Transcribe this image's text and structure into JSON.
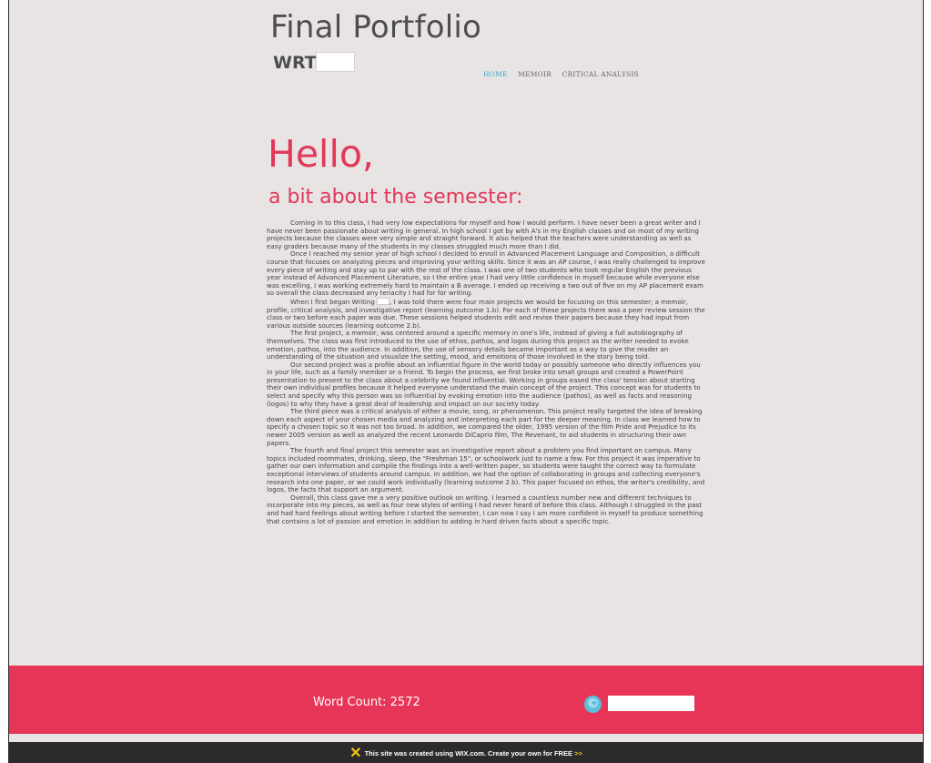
{
  "header": {
    "title": "Final Portfolio",
    "course": "WRT"
  },
  "nav": {
    "items": [
      "HOME",
      "MEMOIR",
      "CRITICAL ANALYSIS"
    ],
    "active": "HOME"
  },
  "main": {
    "greeting": "Hello,",
    "subtitle": "a bit about the semester:",
    "p1": "Coming in to this class, I had very low expectations for myself and how I would perform.  I have never been a great writer and I have never been passionate about writing in general.  In high school I got by with A's in my English classes and on most of my writing projects because the classes were very simple and straight forward.  It also helped that the teachers were understanding as well as easy graders because many of the students in my classes struggled much more than I did.",
    "p2": "Once I reached my senior year of high school I decided to enroll in Advanced Placement Language and Composition, a difficult course that focuses on analyzing pieces and improving your writing skills.  Since it was an AP course, I was really challenged to improve every piece of writing and stay up to par with the rest of the class.  I was one of two students who took regular English the previous year instead of Advanced Placement Literature, so I the entire year I had very little confidence in myself because while everyone else was excelling, I was working extremely hard to maintain a B average.  I ended up receiving a two out of five on my AP placement exam so overall the class decreased any tenacity I had for for writing.",
    "p3_before": "When I first began Writing ",
    "p3_after": ", I was told there were four main projects we would be focusing on this semester; a memoir, profile, critical analysis, and investigative report (learning outcome 1.b).  For each of these projects there was a peer review session the class or two before each paper was due.  These sessions helped students edit and revise their papers because they had input from various outside sources (learning outcome 2.b).",
    "p4": "The first project, a memoir, was centered around a specific memory in one's life, instead of giving a full autobiography of themselves.  The class was first introduced to the use of ethos, pathos, and logos during this project as the writer needed to evoke emotion, pathos, into the audience.  In addition, the use of sensory details became important as a way to give the reader an understanding of the situation and visualize the setting, mood, and emotions of those involved in the story being told.",
    "p5": "Our second project was a profile about an influential figure in the world today or possibly someone who directly influences you in your life, such as a family member or a friend.  To begin the process, we first broke into small groups and created a PowerPoint presentation to present to the class about a celebrity we found influential.  Working in groups eased the class' tension about starting their own individual profiles because it helped everyone understand the main concept of the project.  This concept was for students to select and specify why this person was so influential by evoking emotion into the audience (pathos), as well as facts and reasoning (logos) to why they have a great deal of leadership and impact on our society today.",
    "p6": "The third piece was a critical analysis of either a movie, song, or phenomenon.  This project really targeted the idea of breaking down each aspect of your chosen media and analyzing and interpreting each part for the deeper meaning.  In class we learned how to specify a chosen topic so it was not too broad.  In addition, we compared the older, 1995 version of the film Pride and Prejudice to its newer 2005 version as well as analyzed the recent Leonardo DiCaprio film, The Revenant, to aid students in structuring their own papers.",
    "p7": "The fourth and final project this semester was an investigative report about a problem you find important on campus.  Many topics included roommates, drinking, sleep, the \"Freshman 15\", or schoolwork just to name a few.  For this project it was imperative to gather our own information and compile the findings into a well-written paper, so students were taught the correct way to formulate exceptional interviews of students around campus.  In addition, we had the option of collaborating in groups and collecting everyone's research into one paper, or we could work individually (learning outcome 2.b).  This paper focused on ethos, the writer's credibility, and logos, the facts that support an argument.",
    "p8": "Overall, this class gave me a very positive outlook on writing.  I learned a countless number new and different techniques to incorporate into my pieces, as well as four new styles of writing I had never heard of before this class.  Although I struggled in the past and had hard feelings about writing before I started the semester, I can now I say I am more confident in myself to produce something that contains a lot of passion and emotion in addition to adding in hard driven facts about a specific topic."
  },
  "footer": {
    "word_count": "Word Count: 2572",
    "copyright_symbol": "©"
  },
  "wix_banner": {
    "text": "This site was created using WIX.com. Create your own for FREE",
    "arrows": ">>"
  },
  "colors": {
    "accent": "#e2385a",
    "footer_band": "#e63556",
    "nav_active": "#35a9c9",
    "background": "#e8e4e3"
  }
}
